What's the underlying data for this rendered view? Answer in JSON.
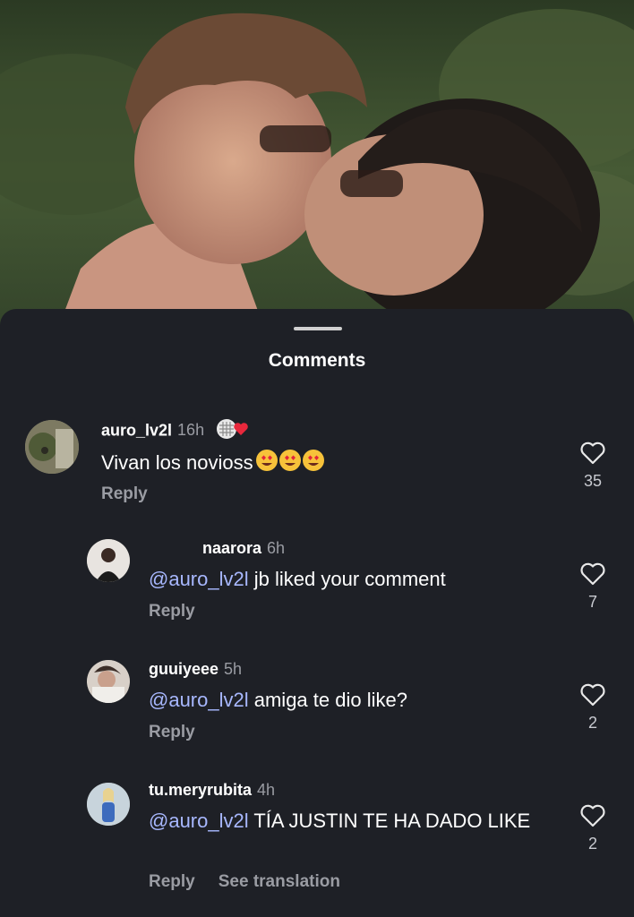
{
  "header": {
    "title": "Comments"
  },
  "comments": [
    {
      "username": "auro_lv2l",
      "time": "16h",
      "text": "Vivan los novioss",
      "emoji": "heart-eyes-emoji",
      "reply_label": "Reply",
      "likes": "35"
    },
    {
      "username": "naarora",
      "time": "6h",
      "mention": "@auro_lv2l",
      "text": "jb liked your comment",
      "reply_label": "Reply",
      "likes": "7"
    },
    {
      "username": "guuiyeee",
      "time": "5h",
      "mention": "@auro_lv2l",
      "text": "amiga te dio like?",
      "reply_label": "Reply",
      "likes": "2"
    },
    {
      "username": "tu.meryrubita",
      "time": "4h",
      "mention": "@auro_lv2l",
      "text": "TÍA JUSTIN TE HA DADO LIKE",
      "reply_label": "Reply",
      "translate_label": "See translation",
      "likes": "2"
    }
  ],
  "colors": {
    "sheet": "#1e2026",
    "mention": "#a8b8ff",
    "muted": "#9a9ca3"
  }
}
